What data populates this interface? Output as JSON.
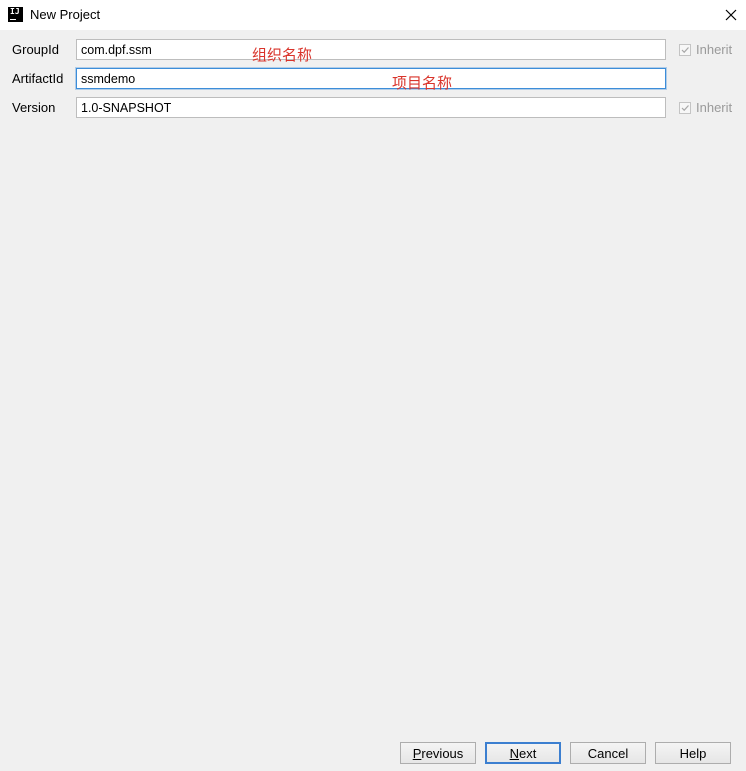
{
  "window": {
    "title": "New Project",
    "icon": "intellij-idea-icon",
    "close_icon": "close-icon"
  },
  "form": {
    "group_id": {
      "label": "GroupId",
      "value": "com.dpf.ssm",
      "annotation": "组织名称",
      "inherit_label": "Inherit",
      "inherit_checked": true
    },
    "artifact_id": {
      "label": "ArtifactId",
      "value": "ssmdemo",
      "annotation": "项目名称"
    },
    "version": {
      "label": "Version",
      "value": "1.0-SNAPSHOT",
      "inherit_label": "Inherit",
      "inherit_checked": true
    }
  },
  "buttons": {
    "previous": {
      "mnemonic": "P",
      "rest": "revious"
    },
    "next": {
      "mnemonic": "N",
      "rest": "ext"
    },
    "cancel": "Cancel",
    "help": "Help"
  },
  "colors": {
    "annotation": "#d9342b",
    "focus_border": "#3c8dd9",
    "background": "#f0f0f0"
  }
}
